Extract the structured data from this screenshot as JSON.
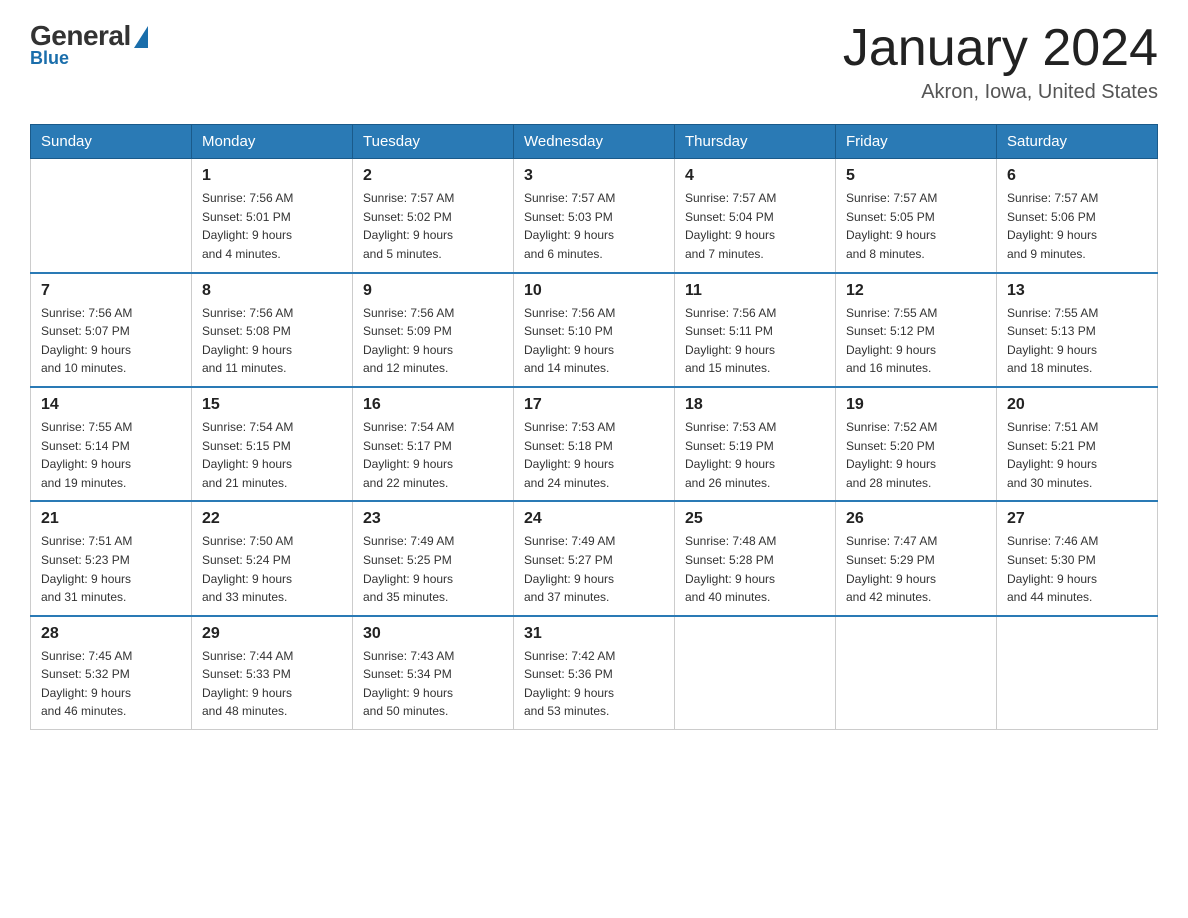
{
  "header": {
    "logo_general": "General",
    "logo_blue": "Blue",
    "month_title": "January 2024",
    "location": "Akron, Iowa, United States"
  },
  "days_of_week": [
    "Sunday",
    "Monday",
    "Tuesday",
    "Wednesday",
    "Thursday",
    "Friday",
    "Saturday"
  ],
  "weeks": [
    [
      {
        "day": "",
        "info": ""
      },
      {
        "day": "1",
        "info": "Sunrise: 7:56 AM\nSunset: 5:01 PM\nDaylight: 9 hours\nand 4 minutes."
      },
      {
        "day": "2",
        "info": "Sunrise: 7:57 AM\nSunset: 5:02 PM\nDaylight: 9 hours\nand 5 minutes."
      },
      {
        "day": "3",
        "info": "Sunrise: 7:57 AM\nSunset: 5:03 PM\nDaylight: 9 hours\nand 6 minutes."
      },
      {
        "day": "4",
        "info": "Sunrise: 7:57 AM\nSunset: 5:04 PM\nDaylight: 9 hours\nand 7 minutes."
      },
      {
        "day": "5",
        "info": "Sunrise: 7:57 AM\nSunset: 5:05 PM\nDaylight: 9 hours\nand 8 minutes."
      },
      {
        "day": "6",
        "info": "Sunrise: 7:57 AM\nSunset: 5:06 PM\nDaylight: 9 hours\nand 9 minutes."
      }
    ],
    [
      {
        "day": "7",
        "info": "Sunrise: 7:56 AM\nSunset: 5:07 PM\nDaylight: 9 hours\nand 10 minutes."
      },
      {
        "day": "8",
        "info": "Sunrise: 7:56 AM\nSunset: 5:08 PM\nDaylight: 9 hours\nand 11 minutes."
      },
      {
        "day": "9",
        "info": "Sunrise: 7:56 AM\nSunset: 5:09 PM\nDaylight: 9 hours\nand 12 minutes."
      },
      {
        "day": "10",
        "info": "Sunrise: 7:56 AM\nSunset: 5:10 PM\nDaylight: 9 hours\nand 14 minutes."
      },
      {
        "day": "11",
        "info": "Sunrise: 7:56 AM\nSunset: 5:11 PM\nDaylight: 9 hours\nand 15 minutes."
      },
      {
        "day": "12",
        "info": "Sunrise: 7:55 AM\nSunset: 5:12 PM\nDaylight: 9 hours\nand 16 minutes."
      },
      {
        "day": "13",
        "info": "Sunrise: 7:55 AM\nSunset: 5:13 PM\nDaylight: 9 hours\nand 18 minutes."
      }
    ],
    [
      {
        "day": "14",
        "info": "Sunrise: 7:55 AM\nSunset: 5:14 PM\nDaylight: 9 hours\nand 19 minutes."
      },
      {
        "day": "15",
        "info": "Sunrise: 7:54 AM\nSunset: 5:15 PM\nDaylight: 9 hours\nand 21 minutes."
      },
      {
        "day": "16",
        "info": "Sunrise: 7:54 AM\nSunset: 5:17 PM\nDaylight: 9 hours\nand 22 minutes."
      },
      {
        "day": "17",
        "info": "Sunrise: 7:53 AM\nSunset: 5:18 PM\nDaylight: 9 hours\nand 24 minutes."
      },
      {
        "day": "18",
        "info": "Sunrise: 7:53 AM\nSunset: 5:19 PM\nDaylight: 9 hours\nand 26 minutes."
      },
      {
        "day": "19",
        "info": "Sunrise: 7:52 AM\nSunset: 5:20 PM\nDaylight: 9 hours\nand 28 minutes."
      },
      {
        "day": "20",
        "info": "Sunrise: 7:51 AM\nSunset: 5:21 PM\nDaylight: 9 hours\nand 30 minutes."
      }
    ],
    [
      {
        "day": "21",
        "info": "Sunrise: 7:51 AM\nSunset: 5:23 PM\nDaylight: 9 hours\nand 31 minutes."
      },
      {
        "day": "22",
        "info": "Sunrise: 7:50 AM\nSunset: 5:24 PM\nDaylight: 9 hours\nand 33 minutes."
      },
      {
        "day": "23",
        "info": "Sunrise: 7:49 AM\nSunset: 5:25 PM\nDaylight: 9 hours\nand 35 minutes."
      },
      {
        "day": "24",
        "info": "Sunrise: 7:49 AM\nSunset: 5:27 PM\nDaylight: 9 hours\nand 37 minutes."
      },
      {
        "day": "25",
        "info": "Sunrise: 7:48 AM\nSunset: 5:28 PM\nDaylight: 9 hours\nand 40 minutes."
      },
      {
        "day": "26",
        "info": "Sunrise: 7:47 AM\nSunset: 5:29 PM\nDaylight: 9 hours\nand 42 minutes."
      },
      {
        "day": "27",
        "info": "Sunrise: 7:46 AM\nSunset: 5:30 PM\nDaylight: 9 hours\nand 44 minutes."
      }
    ],
    [
      {
        "day": "28",
        "info": "Sunrise: 7:45 AM\nSunset: 5:32 PM\nDaylight: 9 hours\nand 46 minutes."
      },
      {
        "day": "29",
        "info": "Sunrise: 7:44 AM\nSunset: 5:33 PM\nDaylight: 9 hours\nand 48 minutes."
      },
      {
        "day": "30",
        "info": "Sunrise: 7:43 AM\nSunset: 5:34 PM\nDaylight: 9 hours\nand 50 minutes."
      },
      {
        "day": "31",
        "info": "Sunrise: 7:42 AM\nSunset: 5:36 PM\nDaylight: 9 hours\nand 53 minutes."
      },
      {
        "day": "",
        "info": ""
      },
      {
        "day": "",
        "info": ""
      },
      {
        "day": "",
        "info": ""
      }
    ]
  ]
}
